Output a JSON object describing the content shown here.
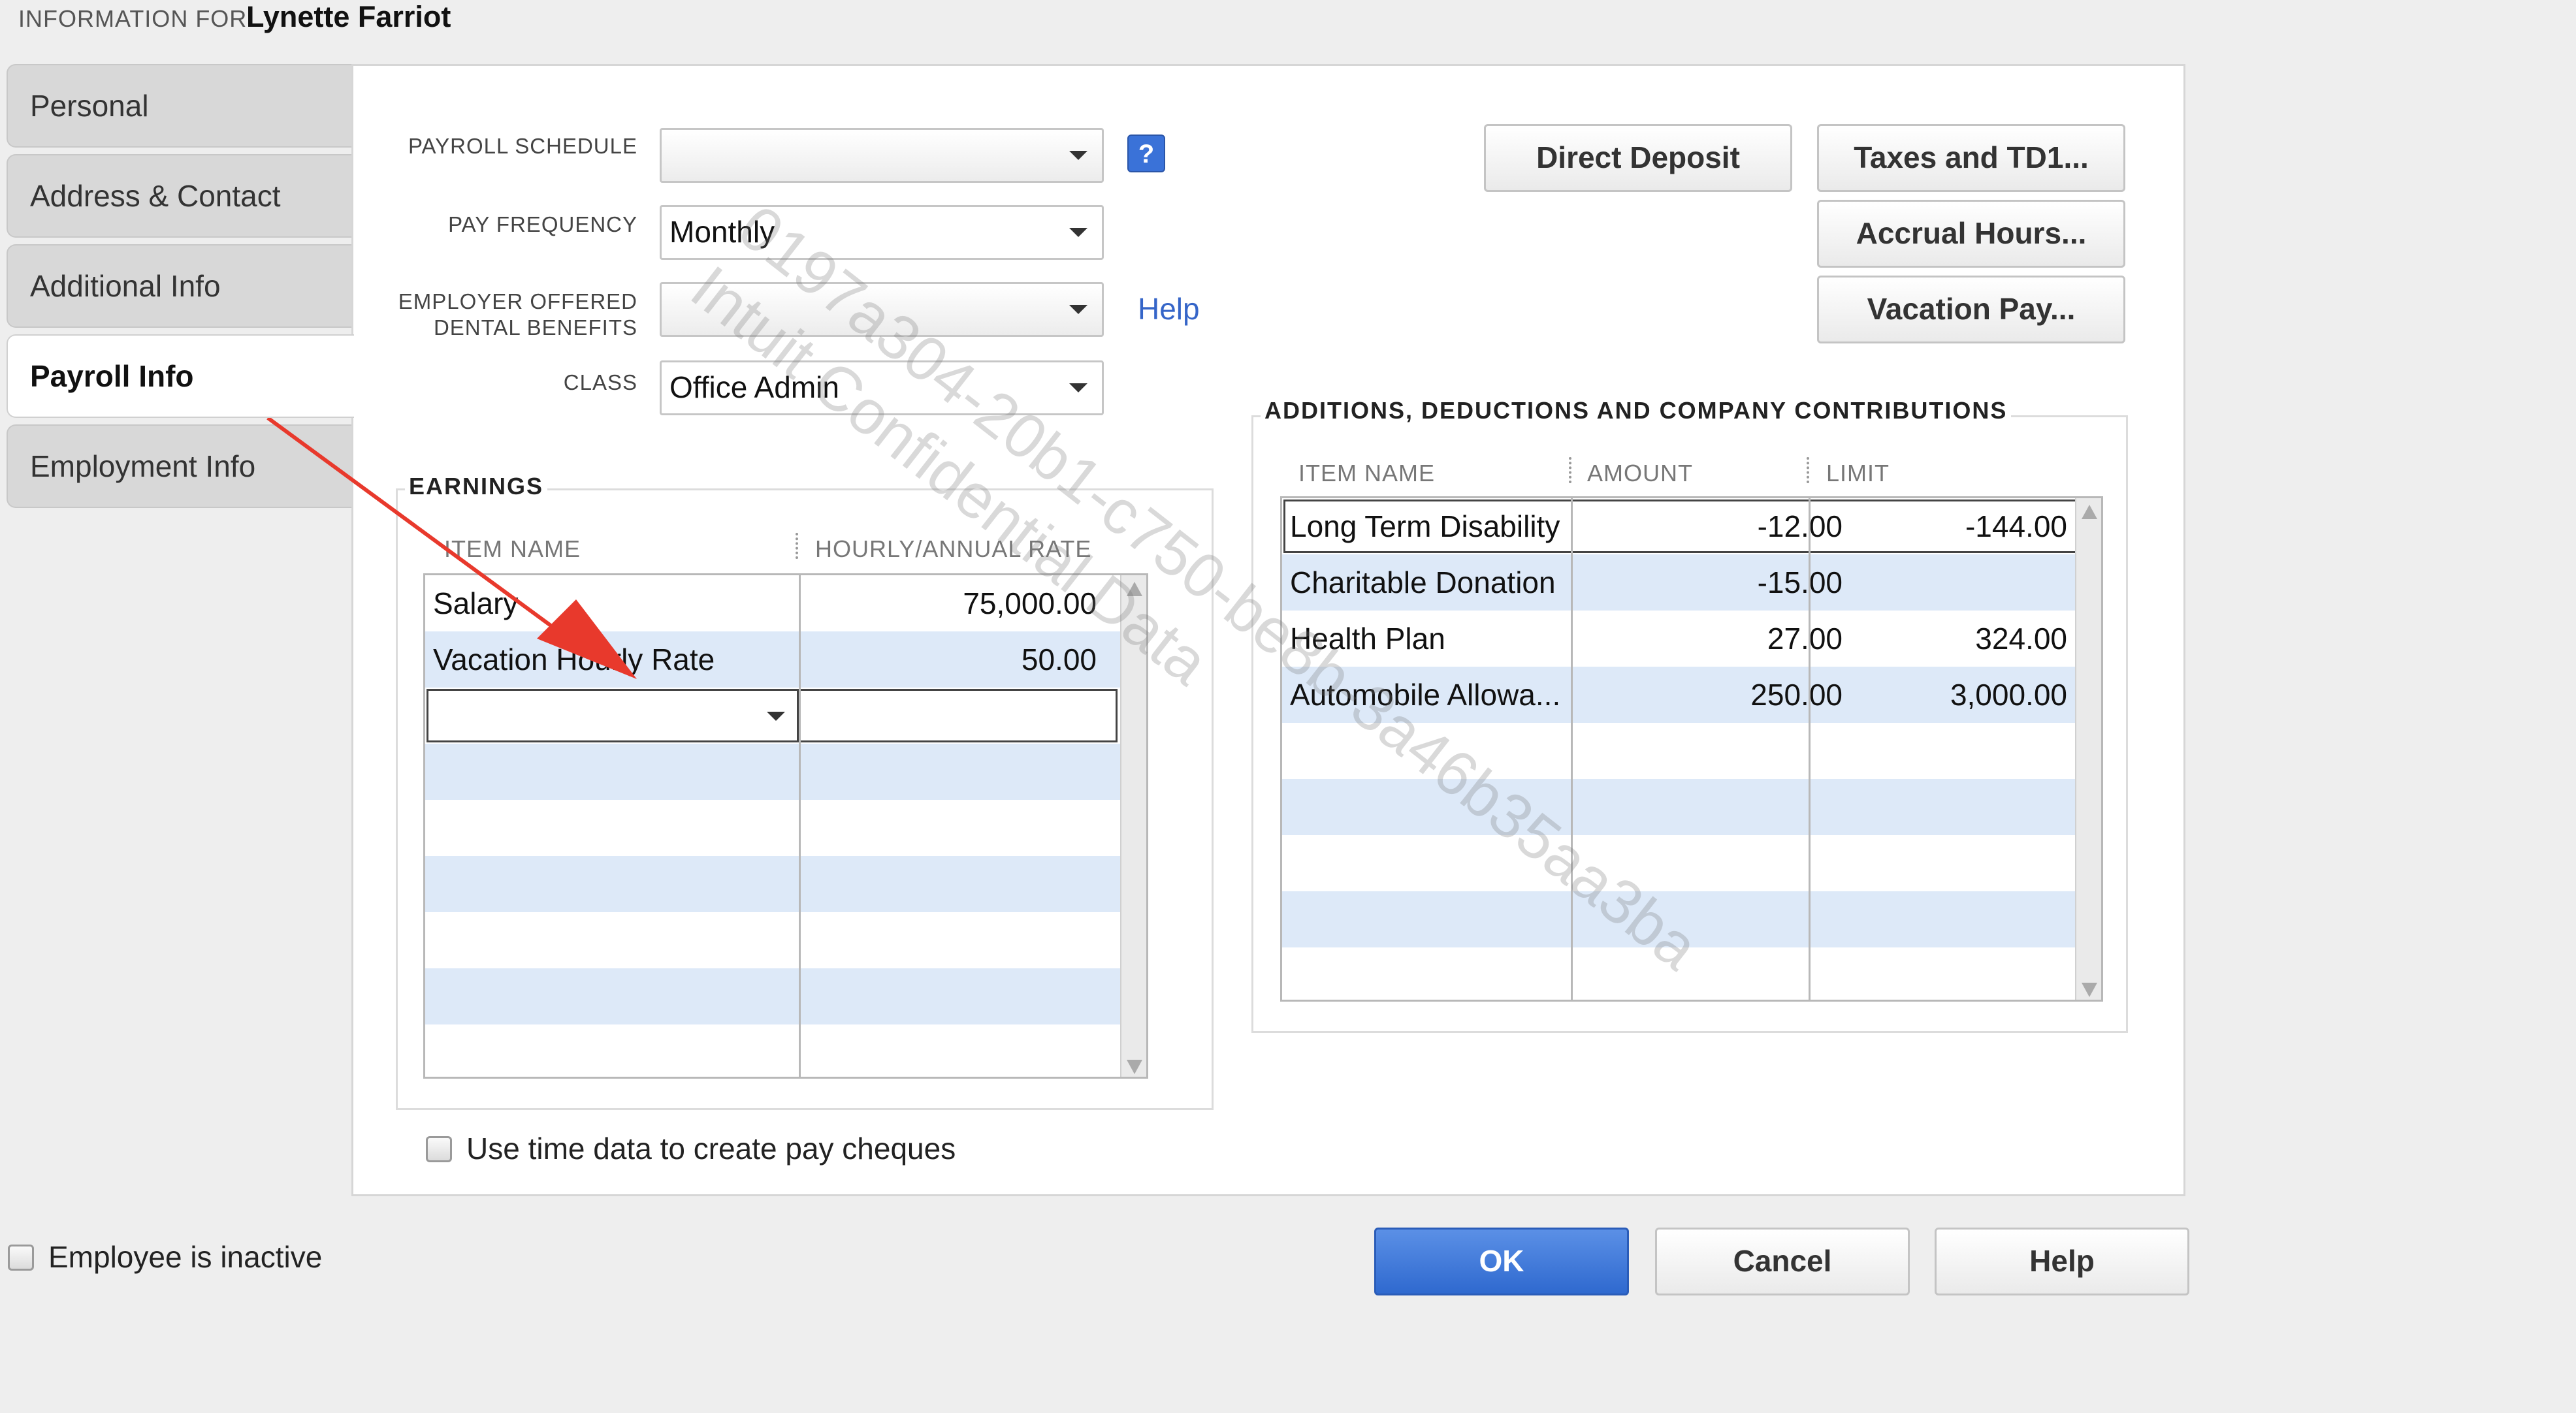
{
  "header": {
    "label": "INFORMATION FOR",
    "employee_name": "Lynette Farriot"
  },
  "tabs": [
    {
      "label": "Personal"
    },
    {
      "label": "Address & Contact"
    },
    {
      "label": "Additional Info"
    },
    {
      "label": "Payroll Info",
      "active": true
    },
    {
      "label": "Employment Info"
    }
  ],
  "form": {
    "payroll_schedule": {
      "label": "PAYROLL SCHEDULE",
      "value": ""
    },
    "help_badge": "?",
    "pay_frequency": {
      "label": "PAY FREQUENCY",
      "value": "Monthly"
    },
    "dental": {
      "label_line1": "EMPLOYER OFFERED",
      "label_line2": "DENTAL BENEFITS",
      "value": ""
    },
    "dental_help_link": "Help",
    "class": {
      "label": "CLASS",
      "value": "Office Admin"
    }
  },
  "buttons": {
    "direct_deposit": "Direct Deposit",
    "taxes": "Taxes and TD1...",
    "accrual": "Accrual Hours...",
    "vacation": "Vacation Pay...",
    "ok": "OK",
    "cancel": "Cancel",
    "help": "Help"
  },
  "earnings": {
    "title": "EARNINGS",
    "col_item": "ITEM NAME",
    "col_rate": "HOURLY/ANNUAL RATE",
    "rows": [
      {
        "item": "Salary",
        "rate": "75,000.00"
      },
      {
        "item": "Vacation Hourly Rate",
        "rate": "50.00"
      }
    ]
  },
  "deductions": {
    "title": "ADDITIONS, DEDUCTIONS AND COMPANY CONTRIBUTIONS",
    "col_item": "ITEM NAME",
    "col_amount": "AMOUNT",
    "col_limit": "LIMIT",
    "rows": [
      {
        "item": "Long Term Disability",
        "amount": "-12.00",
        "limit": "-144.00"
      },
      {
        "item": "Charitable Donation",
        "amount": "-15.00",
        "limit": ""
      },
      {
        "item": "Health Plan",
        "amount": "27.00",
        "limit": "324.00"
      },
      {
        "item": "Automobile Allowa...",
        "amount": "250.00",
        "limit": "3,000.00"
      }
    ]
  },
  "use_time_data": {
    "label": "Use time data to create pay cheques",
    "checked": false
  },
  "employee_inactive": {
    "label": "Employee is inactive",
    "checked": false
  },
  "watermark": {
    "line1": "0197a304-20b1-c750-be8b-3a46b35aa3ba",
    "line2": "Intuit Confidential Data"
  },
  "colors": {
    "accent": "#2f69cf",
    "row_alt": "#dde9f8",
    "annotation_arrow": "#e8392c"
  }
}
